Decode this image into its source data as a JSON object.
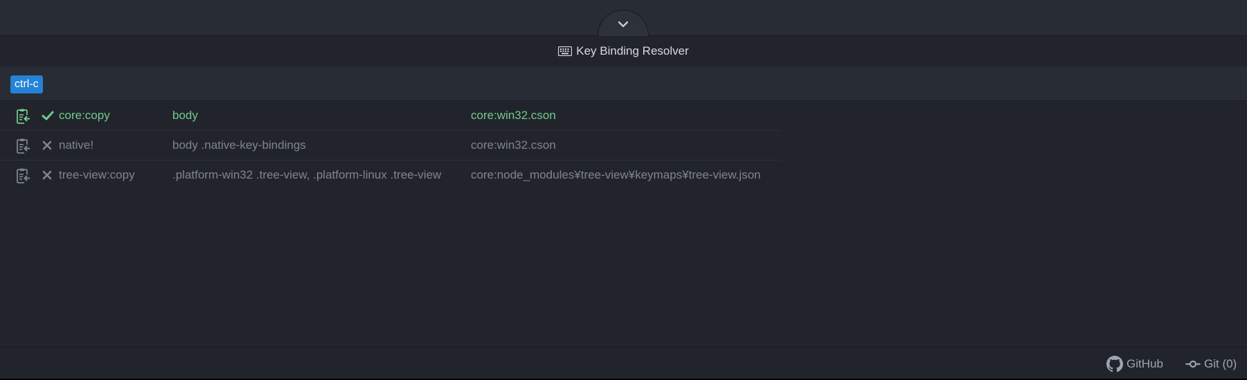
{
  "panel": {
    "title": "Key Binding Resolver",
    "title_icon": "keyboard-icon",
    "toggle_icon": "chevron-down-icon"
  },
  "keystroke": "ctrl-c",
  "bindings": [
    {
      "status": "matched",
      "status_icon": "check-icon",
      "action_icon": "clipboard-icon",
      "command": "core:copy",
      "selector": "body",
      "source": "core:win32.cson"
    },
    {
      "status": "unmatched",
      "status_icon": "x-icon",
      "action_icon": "clipboard-icon",
      "command": "native!",
      "selector": "body .native-key-bindings",
      "source": "core:win32.cson"
    },
    {
      "status": "unmatched",
      "status_icon": "x-icon",
      "action_icon": "clipboard-icon",
      "command": "tree-view:copy",
      "selector": ".platform-win32 .tree-view, .platform-linux .tree-view",
      "source": "core:node_modules¥tree-view¥keymaps¥tree-view.json"
    }
  ],
  "status_bar": {
    "github_label": "GitHub",
    "github_icon": "github-icon",
    "git_label": "Git (0)",
    "git_icon": "git-commit-icon"
  },
  "colors": {
    "matched": "#73c990",
    "unmatched": "#7f848e",
    "keystroke_bg": "#2483d6"
  }
}
